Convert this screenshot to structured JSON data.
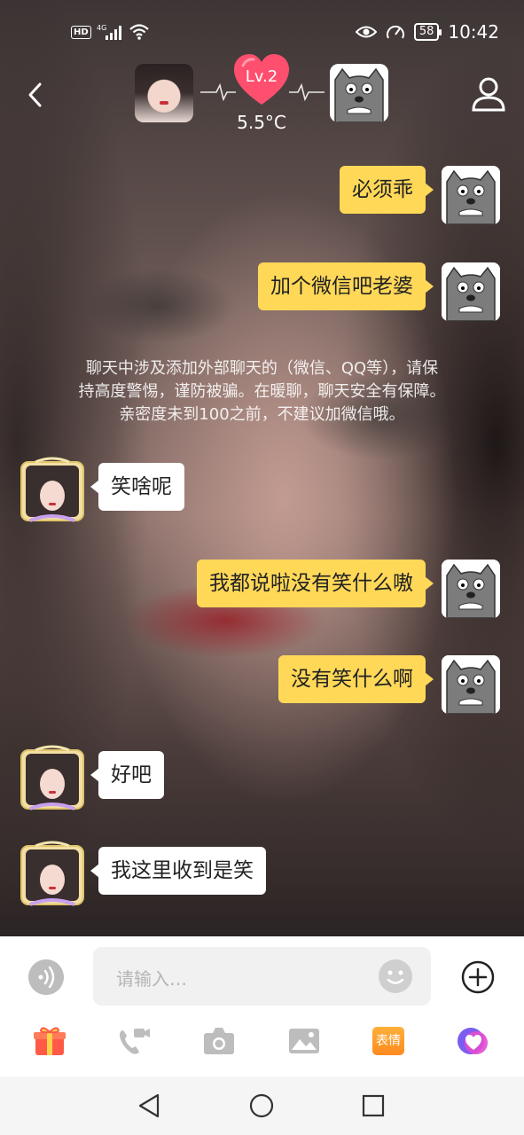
{
  "status_bar": {
    "hd_badge": "HD",
    "network": "4G",
    "battery": "58",
    "time": "10:42"
  },
  "header": {
    "level": "Lv.2",
    "temperature": "5.5°C"
  },
  "messages": [
    {
      "side": "right",
      "text": "必须乖"
    },
    {
      "side": "right",
      "text": "加个微信吧老婆"
    },
    {
      "side": "left",
      "text": "笑啥呢"
    },
    {
      "side": "right",
      "text": "我都说啦没有笑什么嗷"
    },
    {
      "side": "right",
      "text": "没有笑什么啊"
    },
    {
      "side": "left",
      "text": "好吧"
    },
    {
      "side": "left",
      "text": "我这里收到是笑"
    }
  ],
  "notice": {
    "line1": "聊天中涉及添加外部聊天的（微信、QQ等），请保",
    "line2": "持高度警惕，谨防被骗。在暖聊，聊天安全有保障。",
    "line3": "亲密度未到100之前，不建议加微信哦。"
  },
  "input": {
    "placeholder": "请输入…"
  },
  "toolbar": {
    "sticker_label": "表情",
    "icons": [
      "gift-icon",
      "video-call-icon",
      "camera-icon",
      "image-icon",
      "sticker-icon",
      "heart-chat-icon"
    ]
  },
  "colors": {
    "my_bubble": "#ffd858",
    "their_bubble": "#ffffff",
    "level_heart": "#ff4f6e"
  }
}
